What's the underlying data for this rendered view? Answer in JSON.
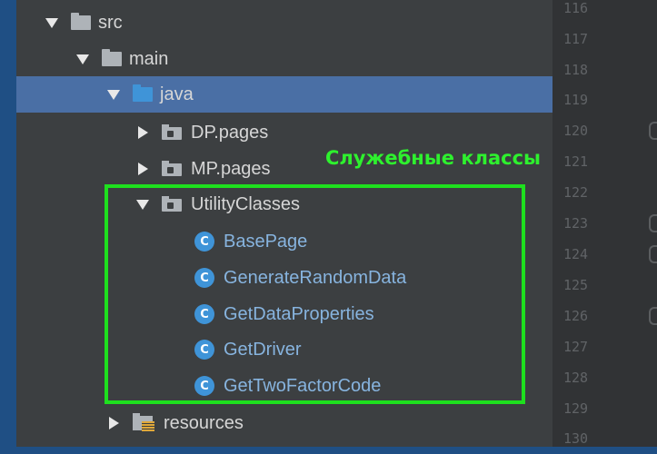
{
  "tree": {
    "src": "src",
    "main": "main",
    "java": "java",
    "dp_pages": "DP.pages",
    "mp_pages": "MP.pages",
    "utility_classes": "UtilityClasses",
    "classes": [
      "BasePage",
      "GenerateRandomData",
      "GetDataProperties",
      "GetDriver",
      "GetTwoFactorCode"
    ],
    "class_icon_letter": "C",
    "resources": "resources"
  },
  "annotation": {
    "text": "Служебные классы",
    "color": "#2ef12e"
  },
  "gutter": {
    "line_numbers": [
      "116",
      "117",
      "118",
      "119",
      "120",
      "121",
      "122",
      "123",
      "124",
      "125",
      "126",
      "127",
      "128",
      "129",
      "130"
    ]
  },
  "colors": {
    "selection": "#4a6fa5",
    "class_text": "#87b4df",
    "class_icon": "#3f94d8",
    "highlight_border": "#1ee01e"
  }
}
